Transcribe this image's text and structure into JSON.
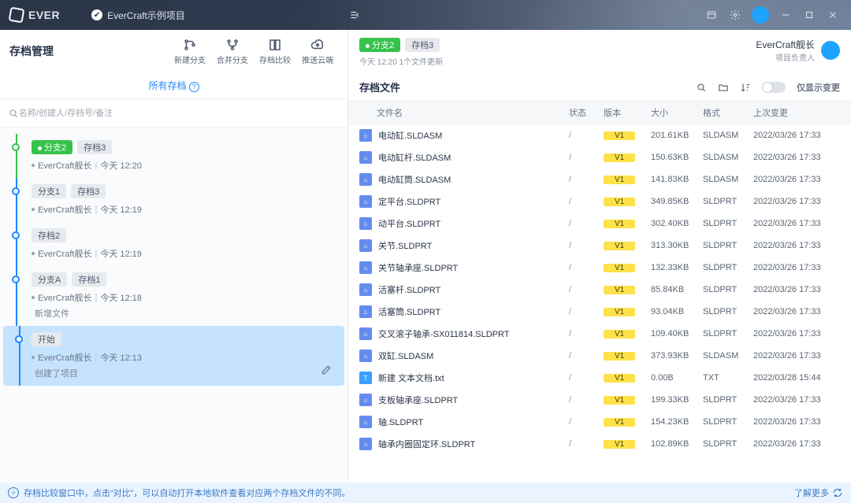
{
  "app": {
    "name": "EVER",
    "project": "EverCraft示例项目"
  },
  "titlebar_icons": [
    "window-icon",
    "settings-icon",
    "avatar-icon",
    "minimize-icon",
    "maximize-icon",
    "close-icon"
  ],
  "left": {
    "title": "存档管理",
    "toolbar": [
      {
        "id": "new-branch",
        "label": "新建分支"
      },
      {
        "id": "merge-branch",
        "label": "合并分支"
      },
      {
        "id": "compare",
        "label": "存档比较"
      },
      {
        "id": "push-cloud",
        "label": "推送云端"
      }
    ],
    "tab": "所有存档",
    "search_placeholder": "名称/创建人/存档号/备注",
    "timeline": [
      {
        "rail": "green",
        "chips": [
          {
            "text": "●分支2",
            "kind": "green"
          },
          {
            "text": "存档3",
            "kind": "gray"
          }
        ],
        "author": "EverCraft舰长",
        "time": "今天 12:20"
      },
      {
        "rail": "blue",
        "chips": [
          {
            "text": "分支1",
            "kind": "gray"
          },
          {
            "text": "存档3",
            "kind": "gray"
          }
        ],
        "author": "EverCraft舰长",
        "time": "今天 12:19"
      },
      {
        "rail": "blue",
        "chips": [
          {
            "text": "存档2",
            "kind": "gray"
          }
        ],
        "author": "EverCraft舰长",
        "time": "今天 12:19"
      },
      {
        "rail": "blue",
        "chips": [
          {
            "text": "分支A",
            "kind": "gray"
          },
          {
            "text": "存档1",
            "kind": "gray"
          }
        ],
        "author": "EverCraft舰长",
        "time": "今天 12:18",
        "sub": "新增文件"
      },
      {
        "rail": "blue",
        "selected": true,
        "chips": [
          {
            "text": "开始",
            "kind": "gray"
          }
        ],
        "author": "EverCraft舰长",
        "time": "今天 12:13",
        "sub": "创建了项目",
        "editable": true
      }
    ]
  },
  "right": {
    "header": {
      "chips": [
        {
          "text": "●分支2",
          "kind": "green"
        },
        {
          "text": "存档3",
          "kind": "gray"
        }
      ],
      "timestamp": "今天 12:20 1个文件更新",
      "owner_name": "EverCraft舰长",
      "owner_role": "项目负责人"
    },
    "section_title": "存档文件",
    "only_changes_label": "仅显示变更",
    "columns": {
      "name": "文件名",
      "status": "状态",
      "version": "版本",
      "size": "大小",
      "format": "格式",
      "mtime": "上次变更"
    },
    "files": [
      {
        "icon": "asm",
        "name": "电动缸.SLDASM",
        "status": "/",
        "ver": "V1",
        "size": "201.61KB",
        "fmt": "SLDASM",
        "time": "2022/03/26 17:33"
      },
      {
        "icon": "asm",
        "name": "电动缸杆.SLDASM",
        "status": "/",
        "ver": "V1",
        "size": "150.63KB",
        "fmt": "SLDASM",
        "time": "2022/03/26 17:33"
      },
      {
        "icon": "asm",
        "name": "电动缸筒.SLDASM",
        "status": "/",
        "ver": "V1",
        "size": "141.83KB",
        "fmt": "SLDASM",
        "time": "2022/03/26 17:33"
      },
      {
        "icon": "asm",
        "name": "定平台.SLDPRT",
        "status": "/",
        "ver": "V1",
        "size": "349.85KB",
        "fmt": "SLDPRT",
        "time": "2022/03/26 17:33"
      },
      {
        "icon": "asm",
        "name": "动平台.SLDPRT",
        "status": "/",
        "ver": "V1",
        "size": "302.40KB",
        "fmt": "SLDPRT",
        "time": "2022/03/26 17:33"
      },
      {
        "icon": "asm",
        "name": "关节.SLDPRT",
        "status": "/",
        "ver": "V1",
        "size": "313.30KB",
        "fmt": "SLDPRT",
        "time": "2022/03/26 17:33"
      },
      {
        "icon": "asm",
        "name": "关节轴承座.SLDPRT",
        "status": "/",
        "ver": "V1",
        "size": "132.33KB",
        "fmt": "SLDPRT",
        "time": "2022/03/26 17:33"
      },
      {
        "icon": "asm",
        "name": "活塞杆.SLDPRT",
        "status": "/",
        "ver": "V1",
        "size": "85.84KB",
        "fmt": "SLDPRT",
        "time": "2022/03/26 17:33"
      },
      {
        "icon": "asm",
        "name": "活塞筒.SLDPRT",
        "status": "/",
        "ver": "V1",
        "size": "93.04KB",
        "fmt": "SLDPRT",
        "time": "2022/03/26 17:33"
      },
      {
        "icon": "asm",
        "name": "交叉滚子轴承-SX011814.SLDPRT",
        "status": "/",
        "ver": "V1",
        "size": "109.40KB",
        "fmt": "SLDPRT",
        "time": "2022/03/26 17:33"
      },
      {
        "icon": "asm",
        "name": "双缸.SLDASM",
        "status": "/",
        "ver": "V1",
        "size": "373.93KB",
        "fmt": "SLDASM",
        "time": "2022/03/26 17:33"
      },
      {
        "icon": "txt",
        "name": "新建 文本文档.txt",
        "status": "/",
        "ver": "V1",
        "size": "0.00B",
        "fmt": "TXT",
        "time": "2022/03/28 15:44"
      },
      {
        "icon": "asm",
        "name": "支板轴承座.SLDPRT",
        "status": "/",
        "ver": "V1",
        "size": "199.33KB",
        "fmt": "SLDPRT",
        "time": "2022/03/26 17:33"
      },
      {
        "icon": "asm",
        "name": "轴.SLDPRT",
        "status": "/",
        "ver": "V1",
        "size": "154.23KB",
        "fmt": "SLDPRT",
        "time": "2022/03/26 17:33"
      },
      {
        "icon": "asm",
        "name": "轴承内圈固定环.SLDPRT",
        "status": "/",
        "ver": "V1",
        "size": "102.89KB",
        "fmt": "SLDPRT",
        "time": "2022/03/26 17:33"
      }
    ]
  },
  "footer": {
    "tip": "存档比较窗口中，点击“对比”，可以自动打开本地软件查看对应两个存档文件的不同。",
    "more": "了解更多"
  }
}
